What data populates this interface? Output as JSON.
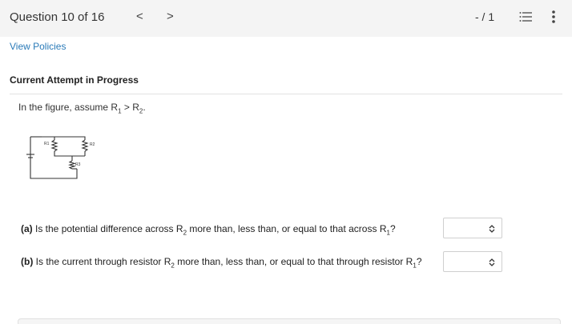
{
  "header": {
    "question_counter": "Question 10 of 16",
    "prev_glyph": "<",
    "next_glyph": ">",
    "score": "- / 1"
  },
  "view_policies": "View Policies",
  "attempt_title": "Current Attempt in Progress",
  "stem": {
    "text": "In the figure, assume R",
    "r1_sub": "1",
    "middle": " > R",
    "r2_sub": "2",
    "end": "."
  },
  "figure": {
    "labels": [
      "R1",
      "R2",
      "R3"
    ],
    "icon": "circuit-diagram"
  },
  "part_a": {
    "label": "(a)",
    "text_1": " Is the potential difference across R",
    "sub_1": "2",
    "text_2": " more than, less than, or equal to that across R",
    "sub_2": "1",
    "text_3": "?",
    "selected": ""
  },
  "part_b": {
    "label": "(b)",
    "text_1": " Is the current through resistor R",
    "sub_1": "2",
    "text_2": " more than, less than, or equal to that through resistor R",
    "sub_2": "1",
    "text_3": "?",
    "selected": ""
  },
  "icons": {
    "list": "list-icon",
    "more": "more-vertical-icon",
    "select_arrows": "up-down-chevron-icon"
  }
}
